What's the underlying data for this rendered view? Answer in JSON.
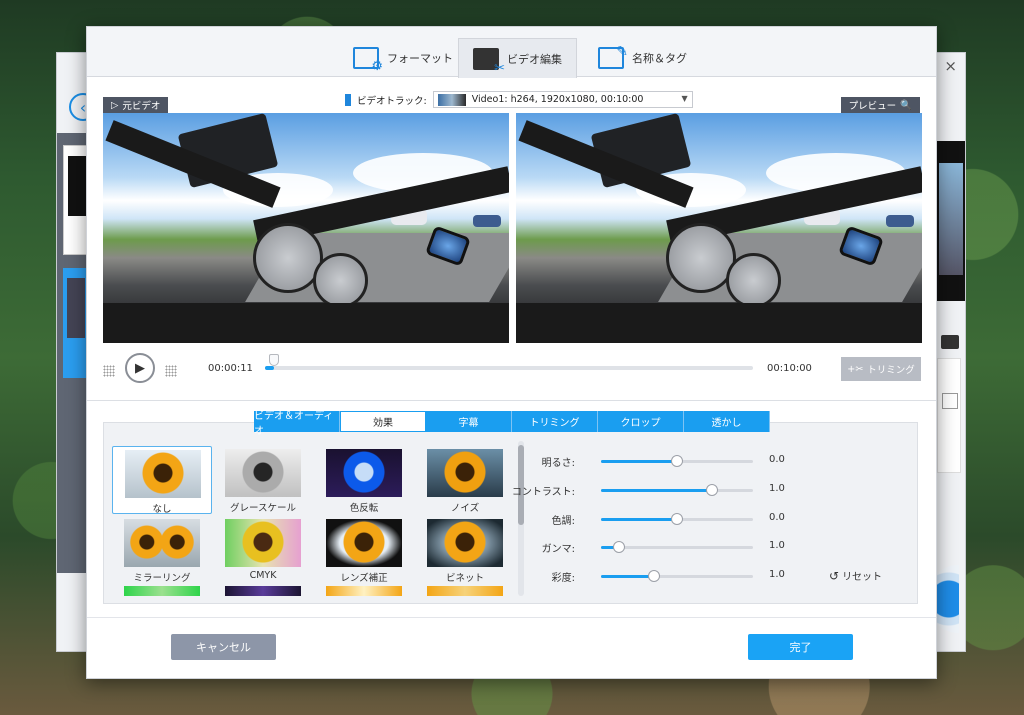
{
  "dialog": {
    "close": "×",
    "tabs": [
      {
        "label": "フォーマット",
        "icon": "format-settings-icon"
      },
      {
        "label": "ビデオ編集",
        "icon": "video-edit-icon"
      },
      {
        "label": "名称＆タグ",
        "icon": "name-tag-edit-icon"
      }
    ],
    "active_tab": 1
  },
  "video": {
    "track_label": "ビデオトラック:",
    "track_value": "Video1: h264, 1920x1080, 00:10:00",
    "source_label": "元ビデオ",
    "preview_label": "プレビュー",
    "current_time": "00:00:11",
    "total_time": "00:10:00",
    "progress_fraction": 0.018,
    "trim_label": "トリミング"
  },
  "subtabs": [
    {
      "label": "ビデオ＆オーディオ"
    },
    {
      "label": "効果"
    },
    {
      "label": "字幕"
    },
    {
      "label": "トリミング"
    },
    {
      "label": "クロップ"
    },
    {
      "label": "透かし"
    }
  ],
  "active_subtab": 1,
  "effects": [
    {
      "label": "なし",
      "style": "none",
      "selected": true
    },
    {
      "label": "グレースケール",
      "style": "grey"
    },
    {
      "label": "色反転",
      "style": "invert"
    },
    {
      "label": "ノイズ",
      "style": "noise"
    },
    {
      "label": "ミラーリング",
      "style": "mirror"
    },
    {
      "label": "CMYK",
      "style": "cmyk"
    },
    {
      "label": "レンズ補正",
      "style": "lens"
    },
    {
      "label": "ビネット",
      "style": "vignette"
    }
  ],
  "adjustments": [
    {
      "label": "明るさ:",
      "value": "0.0",
      "fraction": 0.5
    },
    {
      "label": "コントラスト:",
      "value": "1.0",
      "fraction": 0.73
    },
    {
      "label": "色調:",
      "value": "0.0",
      "fraction": 0.5
    },
    {
      "label": "ガンマ:",
      "value": "1.0",
      "fraction": 0.12
    },
    {
      "label": "彩度:",
      "value": "1.0",
      "fraction": 0.35
    }
  ],
  "reset_label": "リセット",
  "footer": {
    "cancel_label": "キャンセル",
    "ok_label": "完了"
  },
  "colors": {
    "accent": "#1a9ef0",
    "cancel": "#8d96a8",
    "ok": "#1aa3f5",
    "label_tag": "#4e5563"
  }
}
